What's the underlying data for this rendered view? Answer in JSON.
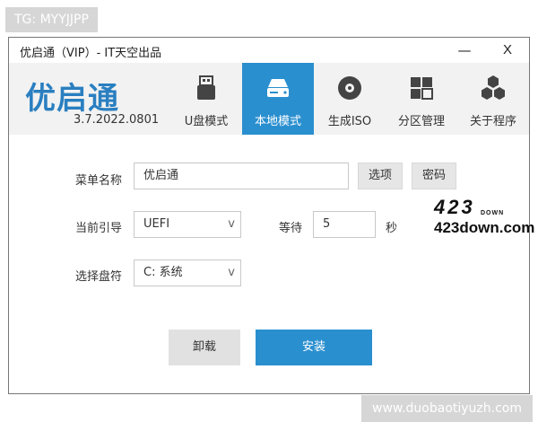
{
  "watermark": {
    "top": "TG: MYYJJPP",
    "bottom": "www.duobaotiyuzh.com"
  },
  "window": {
    "title": "优启通（VIP）- IT天空出品",
    "minimize": "—",
    "close": "X"
  },
  "header": {
    "logo": "优启通",
    "version": "3.7.2022.0801",
    "tabs": [
      {
        "label": "U盘模式",
        "icon": "usb-drive-icon",
        "active": false
      },
      {
        "label": "本地模式",
        "icon": "hard-drive-icon",
        "active": true
      },
      {
        "label": "生成ISO",
        "icon": "disc-icon",
        "active": false
      },
      {
        "label": "分区管理",
        "icon": "partition-grid-icon",
        "active": false
      },
      {
        "label": "关于程序",
        "icon": "about-cubes-icon",
        "active": false
      }
    ]
  },
  "form": {
    "menu_name": {
      "label": "菜单名称",
      "value": "优启通"
    },
    "options_button": "选项",
    "password_button": "密码",
    "boot": {
      "label": "当前引导",
      "value": "UEFI"
    },
    "wait": {
      "label": "等待",
      "value": "5",
      "unit": "秒"
    },
    "disk": {
      "label": "选择盘符",
      "value": "C: 系统"
    },
    "chevron": "v"
  },
  "actions": {
    "uninstall": "卸载",
    "install": "安装"
  },
  "brand": {
    "num": "423",
    "down": "DOWN",
    "url": "423down.com"
  },
  "colors": {
    "accent": "#2a8fcf",
    "logo": "#2a7fc0"
  }
}
